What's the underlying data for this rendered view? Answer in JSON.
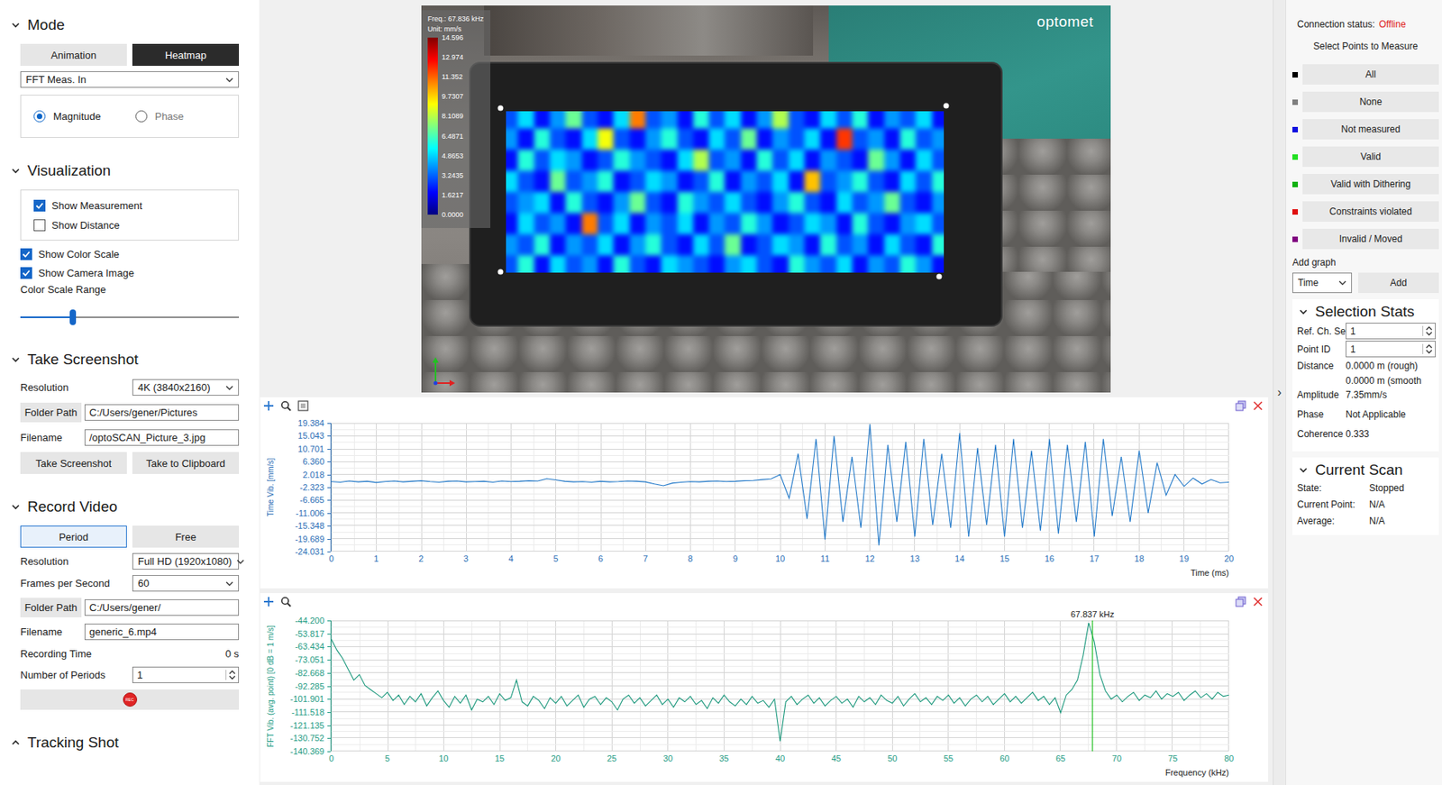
{
  "mode": {
    "title": "Mode",
    "expanded": true,
    "buttons": [
      {
        "label": "Animation",
        "selected": false
      },
      {
        "label": "Heatmap",
        "selected": true
      }
    ],
    "dropdown": {
      "value": "FFT Meas. In"
    },
    "radios": [
      {
        "label": "Magnitude",
        "selected": true
      },
      {
        "label": "Phase",
        "selected": false
      }
    ]
  },
  "visualization": {
    "title": "Visualization",
    "expanded": true,
    "boxed_checks": [
      {
        "label": "Show Measurement",
        "checked": true
      },
      {
        "label": "Show Distance",
        "checked": false
      }
    ],
    "checks": [
      {
        "label": "Show Color Scale",
        "checked": true
      },
      {
        "label": "Show Camera Image",
        "checked": true
      }
    ],
    "slider": {
      "label": "Color Scale Range",
      "level": 0.24
    }
  },
  "screenshot": {
    "title": "Take Screenshot",
    "expanded": true,
    "resolution": {
      "label": "Resolution",
      "value": "4K (3840x2160)"
    },
    "folder": {
      "button": "Folder Path",
      "value": "C:/Users/gener/Pictures"
    },
    "filename": {
      "label": "Filename",
      "value": "/optoSCAN_Picture_3.jpg"
    },
    "buttons": [
      "Take Screenshot",
      "Take to Clipboard"
    ]
  },
  "video": {
    "title": "Record Video",
    "expanded": true,
    "modes": [
      {
        "label": "Period",
        "selected": true
      },
      {
        "label": "Free",
        "selected": false
      }
    ],
    "resolution": {
      "label": "Resolution",
      "value": "Full HD (1920x1080)"
    },
    "fps": {
      "label": "Frames per Second",
      "value": "60"
    },
    "folder": {
      "button": "Folder Path",
      "value": "C:/Users/gener/"
    },
    "filename": {
      "label": "Filename",
      "value": "generic_6.mp4"
    },
    "recording_time": {
      "label": "Recording Time",
      "value": "0 s"
    },
    "periods": {
      "label": "Number of Periods",
      "value": "1"
    },
    "record_button": "REC"
  },
  "tracking_shot": {
    "title": "Tracking Shot",
    "expanded": false
  },
  "camera_view": {
    "color_scale": {
      "freq": "Freq.: 67.836 kHz",
      "unit": "Unit: mm/s",
      "max": 14.596,
      "ticks": [
        "14.596",
        "12.974",
        "11.352",
        "9.7307",
        "8.1089",
        "6.4871",
        "4.8653",
        "3.2435",
        "1.6217",
        "0.0000"
      ]
    },
    "logo": "optomet",
    "heatmap": {
      "rows": [
        [
          3,
          5,
          2,
          4,
          7,
          3,
          2,
          5,
          11,
          3,
          4,
          2,
          6,
          3,
          5,
          2,
          4,
          8,
          3,
          2,
          5,
          3,
          6,
          2,
          4,
          3,
          5,
          2
        ],
        [
          4,
          2,
          6,
          3,
          2,
          5,
          9,
          3,
          2,
          4,
          6,
          3,
          2,
          5,
          3,
          7,
          2,
          4,
          3,
          5,
          2,
          12,
          3,
          4,
          2,
          6,
          3,
          4
        ],
        [
          2,
          6,
          3,
          5,
          4,
          2,
          3,
          6,
          4,
          3,
          2,
          5,
          8,
          3,
          4,
          2,
          6,
          3,
          5,
          2,
          4,
          3,
          2,
          7,
          4,
          2,
          5,
          3
        ],
        [
          5,
          3,
          2,
          7,
          3,
          4,
          6,
          2,
          3,
          5,
          4,
          2,
          3,
          6,
          2,
          4,
          3,
          5,
          2,
          10,
          3,
          4,
          6,
          3,
          2,
          5,
          3,
          6
        ],
        [
          3,
          4,
          5,
          2,
          6,
          3,
          2,
          4,
          7,
          3,
          2,
          6,
          4,
          3,
          5,
          3,
          2,
          4,
          6,
          3,
          2,
          5,
          3,
          4,
          7,
          3,
          2,
          4
        ],
        [
          2,
          5,
          3,
          4,
          2,
          11,
          3,
          5,
          2,
          4,
          3,
          5,
          2,
          4,
          3,
          6,
          4,
          2,
          3,
          5,
          4,
          2,
          6,
          3,
          2,
          4,
          5,
          3
        ],
        [
          4,
          3,
          6,
          2,
          4,
          3,
          5,
          2,
          4,
          6,
          3,
          2,
          5,
          3,
          7,
          2,
          3,
          5,
          4,
          2,
          6,
          3,
          4,
          2,
          5,
          3,
          2,
          6
        ],
        [
          3,
          6,
          2,
          5,
          3,
          4,
          2,
          6,
          3,
          2,
          5,
          4,
          3,
          2,
          4,
          5,
          3,
          2,
          6,
          4,
          3,
          5,
          2,
          4,
          3,
          6,
          4,
          2
        ]
      ]
    }
  },
  "time_chart": {
    "y_label": "Time Vib. [mm/s]",
    "y_ticks": [
      "19.384",
      "15.043",
      "10.701",
      "6.360",
      "2.018",
      "-2.323",
      "-6.665",
      "-11.006",
      "-15.348",
      "-19.689",
      "-24.031"
    ],
    "y_max": 19.384,
    "y_min": -24.031,
    "x_label": "Time (ms)",
    "x_ticks": [
      "0",
      "1",
      "2",
      "3",
      "4",
      "5",
      "6",
      "7",
      "8",
      "9",
      "10",
      "11",
      "12",
      "13",
      "14",
      "15",
      "16",
      "17",
      "18",
      "19",
      "20"
    ],
    "x_min": 0,
    "x_max": 20,
    "series": [
      {
        "name": "Time Vib.",
        "values": [
          -0.4,
          -0.6,
          -0.2,
          -0.5,
          -0.3,
          -0.7,
          -0.4,
          -0.2,
          -0.5,
          -0.3,
          -0.1,
          -0.4,
          -0.6,
          -0.3,
          -0.2,
          -0.5,
          -0.4,
          -0.3,
          -0.6,
          -0.2,
          -0.4,
          -0.3,
          -0.1,
          -0.2,
          0.6,
          0.2,
          -0.3,
          -0.5,
          -0.4,
          -0.6,
          -0.3,
          -0.5,
          -0.4,
          -0.2,
          -0.3,
          -0.5,
          -1.2,
          -1.8,
          -0.9,
          -0.6,
          -0.4,
          -0.5,
          -0.3,
          -0.2,
          -0.4,
          -0.3,
          -0.1,
          0.0,
          0.3,
          0.5,
          2,
          -6,
          9,
          -13,
          14,
          -20,
          15,
          -14,
          8,
          -16,
          19,
          -22,
          12,
          -14,
          13,
          -19,
          14,
          -15,
          9,
          -16,
          16,
          -19,
          11,
          -15,
          12,
          -19,
          14,
          -16,
          10,
          -17,
          14,
          -18,
          12,
          -14,
          13,
          -19,
          14,
          -12,
          8,
          -14,
          10,
          -11,
          6,
          -5,
          2,
          -2,
          0.8,
          -1.2,
          0.3,
          -0.8,
          -0.6
        ]
      }
    ]
  },
  "fft_chart": {
    "y_label": "FFT Vib. (avg. point) [0 dB = 1 m/s]",
    "y_ticks": [
      "-44.200",
      "-53.817",
      "-63.434",
      "-73.051",
      "-82.668",
      "-92.285",
      "-101.901",
      "-111.518",
      "-121.135",
      "-130.752",
      "-140.369"
    ],
    "y_max": -44.2,
    "y_min": -140.369,
    "x_label": "Frequency (kHz)",
    "x_ticks": [
      "0",
      "5",
      "10",
      "15",
      "20",
      "25",
      "30",
      "35",
      "40",
      "45",
      "50",
      "55",
      "60",
      "65",
      "70",
      "75",
      "80"
    ],
    "x_min": 0,
    "x_max": 80,
    "marker": {
      "label": "67.837 kHz",
      "x": 67.837
    },
    "series": [
      {
        "name": "FFT Vib.",
        "values": [
          -58,
          -66,
          -72,
          -80,
          -88,
          -84,
          -92,
          -95,
          -98,
          -101,
          -97,
          -103,
          -99,
          -106,
          -100,
          -104,
          -98,
          -107,
          -101,
          -96,
          -103,
          -108,
          -100,
          -105,
          -99,
          -110,
          -102,
          -104,
          -100,
          -106,
          -98,
          -103,
          -101,
          -88,
          -104,
          -107,
          -100,
          -103,
          -109,
          -101,
          -105,
          -100,
          -107,
          -103,
          -99,
          -108,
          -102,
          -100,
          -106,
          -101,
          -104,
          -110,
          -102,
          -99,
          -105,
          -101,
          -107,
          -103,
          -99,
          -106,
          -102,
          -108,
          -101,
          -104,
          -100,
          -106,
          -103,
          -109,
          -101,
          -105,
          -99,
          -104,
          -107,
          -102,
          -106,
          -100,
          -105,
          -103,
          -108,
          -102,
          -133,
          -104,
          -100,
          -106,
          -102,
          -99,
          -105,
          -101,
          -107,
          -103,
          -100,
          -105,
          -102,
          -108,
          -100,
          -104,
          -101,
          -106,
          -99,
          -103,
          -105,
          -100,
          -107,
          -102,
          -98,
          -104,
          -101,
          -106,
          -100,
          -103,
          -99,
          -105,
          -101,
          -107,
          -102,
          -99,
          -104,
          -100,
          -106,
          -102,
          -98,
          -104,
          -100,
          -105,
          -101,
          -97,
          -103,
          -100,
          -106,
          -101,
          -112,
          -99,
          -95,
          -88,
          -70,
          -46,
          -60,
          -84,
          -96,
          -102,
          -99,
          -104,
          -100,
          -97,
          -103,
          -99,
          -101,
          -96,
          -102,
          -98,
          -100,
          -97,
          -103,
          -99,
          -96,
          -101,
          -98,
          -102,
          -97,
          -100,
          -99
        ]
      }
    ]
  },
  "collapse_toggle": "›",
  "right_panel": {
    "connection": {
      "label": "Connection status:",
      "value": "Offline"
    },
    "select_points": "Select Points to Measure",
    "filters": [
      {
        "label": "All",
        "color": "#000000"
      },
      {
        "label": "None",
        "color": "#7f7f7f"
      },
      {
        "label": "Not measured",
        "color": "#1010e0"
      },
      {
        "label": "Valid",
        "color": "#22e022"
      },
      {
        "label": "Valid with Dithering",
        "color": "#10b010"
      },
      {
        "label": "Constraints violated",
        "color": "#e01010"
      },
      {
        "label": "Invalid / Moved",
        "color": "#800080"
      }
    ],
    "add_graph": {
      "label": "Add graph",
      "type": "Time",
      "button": "Add"
    },
    "selection_stats": {
      "title": "Selection Stats",
      "expanded": true,
      "spinners": [
        {
          "label": "Ref. Ch. Set",
          "value": "1"
        },
        {
          "label": "Point ID",
          "value": "1"
        }
      ],
      "rows": [
        {
          "label": "Distance",
          "values": [
            "0.0000 m (rough)",
            "0.0000 m (smooth"
          ]
        },
        {
          "label": "Amplitude",
          "values": [
            "7.35mm/s"
          ]
        },
        {
          "label": "Phase",
          "values": [
            "Not Applicable"
          ]
        },
        {
          "label": "Coherence",
          "values": [
            "0.333"
          ]
        }
      ]
    },
    "current_scan": {
      "title": "Current Scan",
      "expanded": true,
      "rows": [
        {
          "label": "State:",
          "value": "Stopped"
        },
        {
          "label": "Current Point:",
          "value": "N/A"
        },
        {
          "label": "Average:",
          "value": "N/A"
        }
      ]
    }
  }
}
